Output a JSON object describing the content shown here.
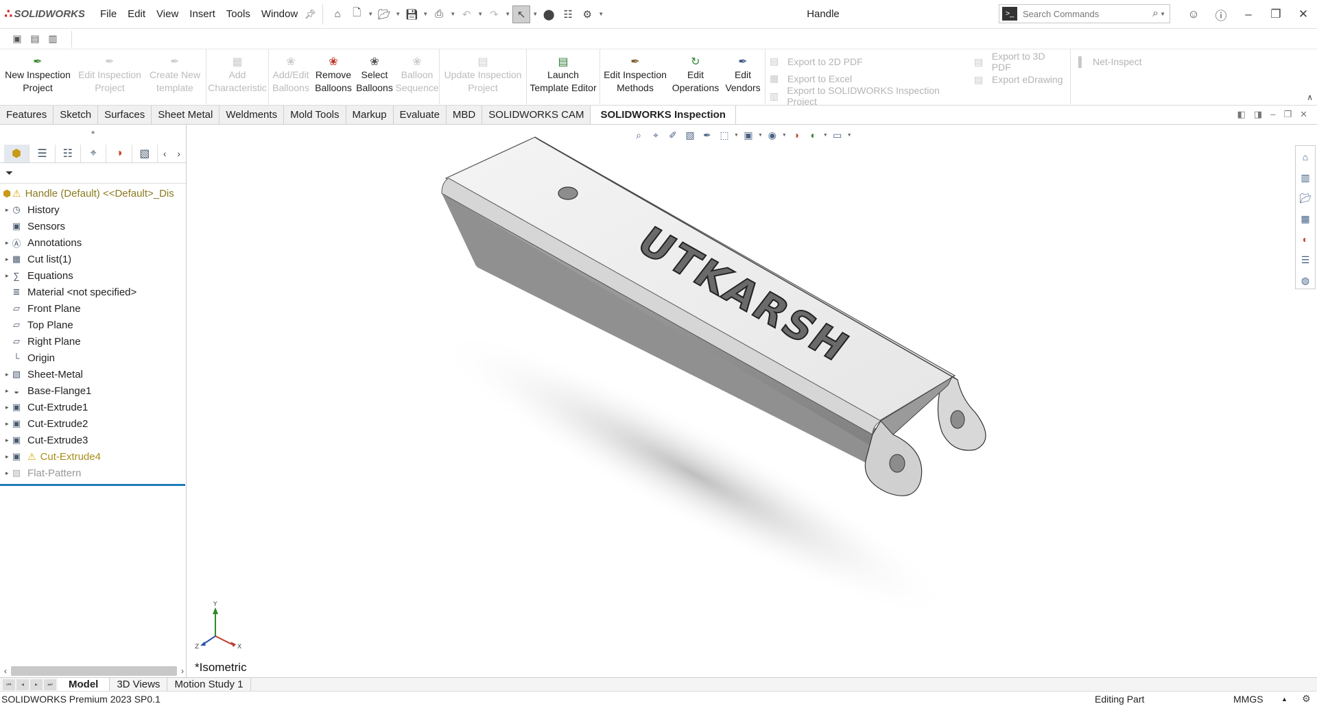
{
  "app": {
    "logo": "SOLIDWORKS",
    "window_title": "Handle"
  },
  "menus": [
    "File",
    "Edit",
    "View",
    "Insert",
    "Tools",
    "Window"
  ],
  "search": {
    "placeholder": "Search Commands"
  },
  "ribbon": {
    "buttons": [
      {
        "line1": "New Inspection",
        "line2": "Project",
        "enabled": true
      },
      {
        "line1": "Edit Inspection",
        "line2": "Project",
        "enabled": false
      },
      {
        "line1": "Create New",
        "line2": "template",
        "enabled": false
      },
      {
        "line1": "Add",
        "line2": "Characteristic",
        "enabled": false
      },
      {
        "line1": "Add/Edit",
        "line2": "Balloons",
        "enabled": false
      },
      {
        "line1": "Remove",
        "line2": "Balloons",
        "enabled": true
      },
      {
        "line1": "Select",
        "line2": "Balloons",
        "enabled": true
      },
      {
        "line1": "Balloon",
        "line2": "Sequence",
        "enabled": false
      },
      {
        "line1": "Update Inspection",
        "line2": "Project",
        "enabled": false
      },
      {
        "line1": "Launch",
        "line2": "Template Editor",
        "enabled": true
      },
      {
        "line1": "Edit Inspection",
        "line2": "Methods",
        "enabled": true
      },
      {
        "line1": "Edit",
        "line2": "Operations",
        "enabled": true
      },
      {
        "line1": "Edit",
        "line2": "Vendors",
        "enabled": true
      }
    ],
    "export_col1": [
      "Export to 2D PDF",
      "Export to Excel",
      "Export to SOLIDWORKS Inspection Project"
    ],
    "export_col2": [
      "Export to 3D PDF",
      "Export eDrawing"
    ],
    "net_inspect": "Net-Inspect"
  },
  "tabs": [
    "Features",
    "Sketch",
    "Surfaces",
    "Sheet Metal",
    "Weldments",
    "Mold Tools",
    "Markup",
    "Evaluate",
    "MBD",
    "SOLIDWORKS CAM",
    "SOLIDWORKS Inspection"
  ],
  "active_tab": "SOLIDWORKS Inspection",
  "tree": {
    "root": "Handle (Default) <<Default>_Dis",
    "nodes": [
      {
        "label": "History",
        "expand": true
      },
      {
        "label": "Sensors",
        "expand": false
      },
      {
        "label": "Annotations",
        "expand": true
      },
      {
        "label": "Cut list(1)",
        "expand": true
      },
      {
        "label": "Equations",
        "expand": true
      },
      {
        "label": "Material <not specified>",
        "expand": false
      },
      {
        "label": "Front Plane",
        "expand": false
      },
      {
        "label": "Top Plane",
        "expand": false
      },
      {
        "label": "Right Plane",
        "expand": false
      },
      {
        "label": "Origin",
        "expand": false
      },
      {
        "label": "Sheet-Metal",
        "expand": true
      },
      {
        "label": "Base-Flange1",
        "expand": true
      },
      {
        "label": "Cut-Extrude1",
        "expand": true
      },
      {
        "label": "Cut-Extrude2",
        "expand": true
      },
      {
        "label": "Cut-Extrude3",
        "expand": true
      },
      {
        "label": "Cut-Extrude4",
        "expand": true,
        "warning": true
      },
      {
        "label": "Flat-Pattern",
        "expand": true,
        "suppressed": true
      }
    ]
  },
  "viewport": {
    "view_name": "*Isometric",
    "engraving": "UTKARSH",
    "triad": {
      "x": "X",
      "y": "Y",
      "z": "Z"
    }
  },
  "bottom_tabs": [
    "Model",
    "3D Views",
    "Motion Study 1"
  ],
  "status": {
    "product": "SOLIDWORKS Premium 2023 SP0.1",
    "mode": "Editing Part",
    "units": "MMGS"
  },
  "colors": {
    "accent": "#1f7ab8",
    "logo_red": "#d9262c",
    "warning": "#e0a800"
  }
}
